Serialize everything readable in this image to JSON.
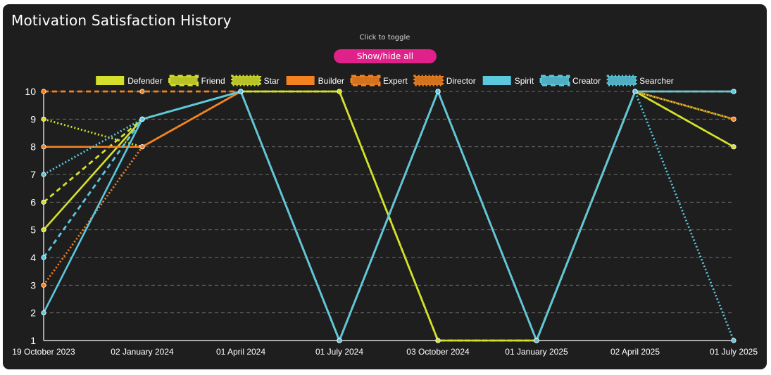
{
  "title": "Motivation Satisfaction History",
  "hint": "Click to toggle",
  "toggle_button": "Show/hide all",
  "chart_data": {
    "type": "line",
    "x": [
      "19 October 2023",
      "02 January 2024",
      "01 April 2024",
      "01 July 2024",
      "03 October 2024",
      "01 January 2025",
      "02 April 2025",
      "01 July 2025"
    ],
    "ylim": [
      1,
      10
    ],
    "yticks": [
      1,
      2,
      3,
      4,
      5,
      6,
      7,
      8,
      9,
      10
    ],
    "grid": true,
    "legend_position": "top",
    "series": [
      {
        "name": "Defender",
        "color": "#d4e02c",
        "style": "solid",
        "values": [
          5,
          9,
          10,
          10,
          1,
          1,
          10,
          8
        ]
      },
      {
        "name": "Friend",
        "color": "#d4e02c",
        "style": "dashed",
        "values": [
          6,
          9,
          10,
          10,
          1,
          1,
          10,
          8
        ]
      },
      {
        "name": "Star",
        "color": "#d4e02c",
        "style": "dotted",
        "values": [
          9,
          8,
          10,
          10,
          1,
          1,
          10,
          9
        ]
      },
      {
        "name": "Builder",
        "color": "#f58220",
        "style": "solid",
        "values": [
          8,
          8,
          10,
          1,
          10,
          1,
          10,
          10
        ]
      },
      {
        "name": "Expert",
        "color": "#f58220",
        "style": "dashed",
        "values": [
          10,
          10,
          10,
          1,
          10,
          1,
          10,
          10
        ]
      },
      {
        "name": "Director",
        "color": "#f58220",
        "style": "dotted",
        "values": [
          3,
          8,
          10,
          1,
          10,
          1,
          10,
          9
        ]
      },
      {
        "name": "Spirit",
        "color": "#5bc8dd",
        "style": "solid",
        "values": [
          2,
          9,
          10,
          1,
          10,
          1,
          10,
          10
        ]
      },
      {
        "name": "Creator",
        "color": "#5bc8dd",
        "style": "dashed",
        "values": [
          4,
          9,
          10,
          1,
          10,
          1,
          10,
          10
        ]
      },
      {
        "name": "Searcher",
        "color": "#5bc8dd",
        "style": "dotted",
        "values": [
          7,
          9,
          10,
          1,
          10,
          1,
          10,
          1
        ]
      }
    ]
  }
}
